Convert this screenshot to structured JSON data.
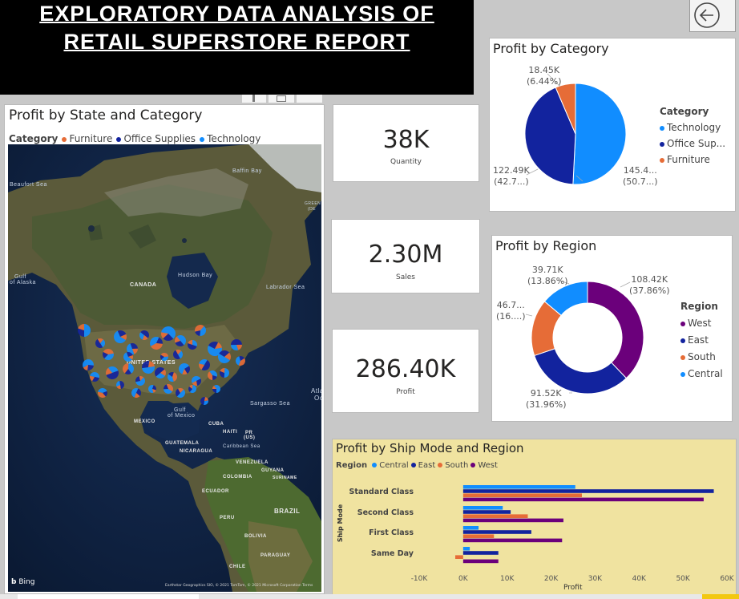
{
  "banner": {
    "line1": "EXPLORATORY  DATA ANALYSIS OF",
    "line2": "RETAIL SUPERSTORE REPORT"
  },
  "back_button": {
    "icon": "arrow-left-circle-icon"
  },
  "map_visual": {
    "title": "Profit by State and Category",
    "legend_title": "Category",
    "legend": [
      {
        "label": "Furniture",
        "color": "#E66C37"
      },
      {
        "label": "Office Supplies",
        "color": "#12239E"
      },
      {
        "label": "Technology",
        "color": "#118DFF"
      }
    ],
    "labels": {
      "beaufort": "Beaufort Sea",
      "baffin": "Baffin Bay",
      "greenland": "GREEN",
      "greenland2": "(DE",
      "gulf_alaska": "Gulf",
      "gulf_alaska2": "of Alaska",
      "hudson": "Hudson Bay",
      "canada": "CANADA",
      "labrador": "Labrador Sea",
      "united_states": "UNITED STATES",
      "atlantic": "Atla",
      "atlantic2": "Oc",
      "sargasso": "Sargasso Sea",
      "gulf_mexico": "Gulf",
      "gulf_mexico2": "of Mexico",
      "mexico": "MEXICO",
      "cuba": "CUBA",
      "haiti": "HAITI",
      "pr": "PR",
      "pr2": "(US)",
      "guatemala": "GUATEMALA",
      "nicaragua": "NICARAGUA",
      "caribbean": "Caribbean Sea",
      "venezuela": "VENEZUELA",
      "guyana": "GUYANA",
      "colombia": "COLOMBIA",
      "suriname": "SURINAME",
      "ecuador": "ECUADOR",
      "brazil": "BRAZIL",
      "peru": "PERU",
      "bolivia": "BOLIVIA",
      "paraguay": "PARAGUAY",
      "chile": "CHILE",
      "bing": "Bing",
      "attribution": "Earthstar Geographics SIO, © 2021 TomTom, © 2021 Microsoft Corporation  Terms"
    }
  },
  "kpis": [
    {
      "value": "38K",
      "label": "Quantity"
    },
    {
      "value": "2.30M",
      "label": "Sales"
    },
    {
      "value": "286.40K",
      "label": "Profit"
    }
  ],
  "category_pie": {
    "title": "Profit by Category",
    "legend_title": "Category",
    "legend": [
      "Technology",
      "Office Sup...",
      "Furniture"
    ],
    "labels": {
      "technology": [
        "145.4...",
        "(50.7...)"
      ],
      "office": [
        "122.49K",
        "(42.7...)"
      ],
      "furniture": [
        "18.45K",
        "(6.44%)"
      ]
    }
  },
  "region_donut": {
    "title": "Profit by Region",
    "legend_title": "Region",
    "legend": [
      "West",
      "East",
      "South",
      "Central"
    ],
    "labels": {
      "west": [
        "108.42K",
        "(37.86%)"
      ],
      "east": [
        "91.52K",
        "(31.96%)"
      ],
      "south": [
        "46.7...",
        "(16....)"
      ],
      "central": [
        "39.71K",
        "(13.86%)"
      ]
    }
  },
  "ship_chart": {
    "title": "Profit by Ship Mode and Region",
    "legend_title": "Region",
    "xlabel": "Profit",
    "ylabel": "Ship Mode",
    "x_ticks": [
      "-10K",
      "0K",
      "10K",
      "20K",
      "30K",
      "40K",
      "50K",
      "60K"
    ]
  },
  "colors": {
    "technology": "#118DFF",
    "office": "#12239E",
    "furniture": "#E66C37",
    "west": "#6B007B",
    "east": "#12239E",
    "south": "#E66C37",
    "central": "#118DFF",
    "ship_bg": "#f0e3a0"
  },
  "chart_data": [
    {
      "type": "pie",
      "title": "Profit by Category",
      "categories": [
        "Technology",
        "Office Supplies",
        "Furniture"
      ],
      "values": [
        145450,
        122490,
        18450
      ],
      "percent": [
        50.79,
        42.77,
        6.44
      ]
    },
    {
      "type": "pie",
      "title": "Profit by Region",
      "categories": [
        "West",
        "East",
        "South",
        "Central"
      ],
      "values": [
        108420,
        91520,
        46750,
        39710
      ],
      "percent": [
        37.86,
        31.96,
        16.32,
        13.86
      ]
    },
    {
      "type": "bar",
      "title": "Profit by Ship Mode and Region",
      "orientation": "horizontal",
      "categories": [
        "Standard Class",
        "Second Class",
        "First Class",
        "Same Day"
      ],
      "series": [
        {
          "name": "Central",
          "values": [
            25500,
            9000,
            3500,
            1500
          ]
        },
        {
          "name": "East",
          "values": [
            57000,
            10800,
            15500,
            8000
          ]
        },
        {
          "name": "South",
          "values": [
            27000,
            14700,
            7000,
            -1800
          ]
        },
        {
          "name": "West",
          "values": [
            54700,
            22800,
            22500,
            8000
          ]
        }
      ],
      "xlabel": "Profit",
      "ylabel": "Ship Mode",
      "xlim": [
        -10000,
        60000
      ]
    }
  ]
}
